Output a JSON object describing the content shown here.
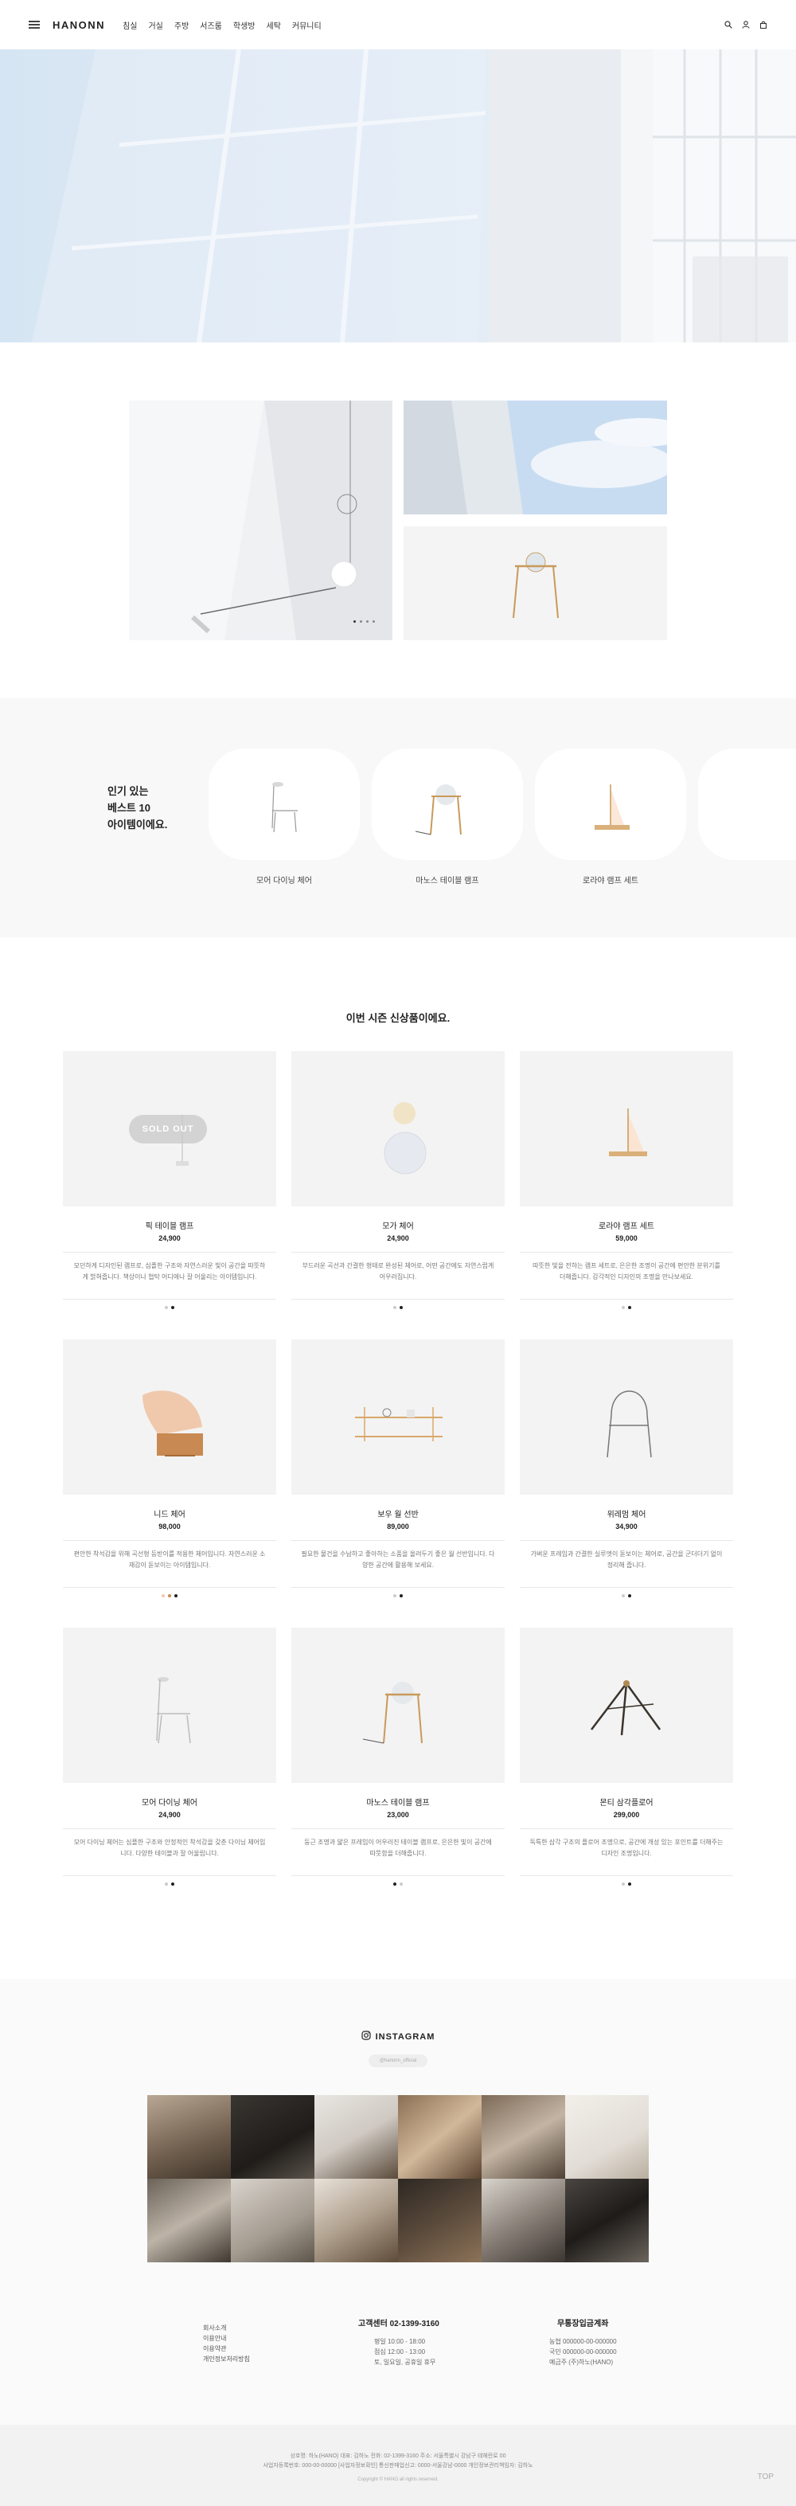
{
  "header": {
    "logo": "HANONN",
    "nav": [
      "침실",
      "거실",
      "주방",
      "서즈룸",
      "학생방",
      "세탁",
      "커뮤니티"
    ]
  },
  "best": {
    "title_lines": [
      "인기 있는",
      "베스트 10",
      "아이템이에요."
    ],
    "items": [
      "모어 다이닝 체어",
      "마노스 테이블 램프",
      "로라야 램프 세트"
    ]
  },
  "new_section": {
    "title": "이번 시즌 신상품이에요.",
    "sold_out": "SOLD OUT",
    "products": [
      {
        "name": "픽 테이블 램프",
        "price": "24,900",
        "desc": "모던하게 디자인된 램프로, 심플한 구조와 자연스러운 빛이 공간을 따뜻하게 밝혀줍니다. 책상이나 협탁 어디에나 잘 어울리는 아이템입니다."
      },
      {
        "name": "모가 체어",
        "price": "24,900",
        "desc": "부드러운 곡선과 간결한 형태로 완성된 체어로, 어떤 공간에도 자연스럽게 어우러집니다."
      },
      {
        "name": "로라야 램프 세트",
        "price": "59,000",
        "desc": "따뜻한 빛을 전하는 램프 세트로, 은은한 조명이 공간에 편안한 분위기를 더해줍니다. 감각적인 디자인의 조명을 만나보세요."
      },
      {
        "name": "니드 체어",
        "price": "98,000",
        "desc": "편안한 착석감을 위해 곡선형 등받이를 적용한 체어입니다. 자연스러운 소재감이 돋보이는 아이템입니다."
      },
      {
        "name": "보우 월 선반",
        "price": "89,000",
        "desc": "필요한 물건을 수납하고 좋아하는 소품을 올려두기 좋은 월 선반입니다. 다양한 공간에 활용해 보세요."
      },
      {
        "name": "위레멈 체어",
        "price": "34,900",
        "desc": "가벼운 프레임과 간결한 실루엣이 돋보이는 체어로, 공간을 군더더기 없이 정리해 줍니다."
      },
      {
        "name": "모어 다이닝 체어",
        "price": "24,900",
        "desc": "모어 다이닝 체어는 심플한 구조와 안정적인 착석감을 갖춘 다이닝 체어입니다. 다양한 테이블과 잘 어울립니다."
      },
      {
        "name": "마노스 테이블 램프",
        "price": "23,000",
        "desc": "둥근 조명과 얇은 프레임이 어우러진 테이블 램프로, 은은한 빛이 공간에 따뜻함을 더해줍니다."
      },
      {
        "name": "몬티 삼각플로어",
        "price": "299,000",
        "desc": "독특한 삼각 구조의 플로어 조명으로, 공간에 개성 있는 포인트를 더해주는 디자인 조명입니다."
      }
    ]
  },
  "instagram": {
    "title": "INSTAGRAM",
    "handle": "@hanonn_official"
  },
  "footer_links": [
    "회사소개",
    "이용안내",
    "이용약관",
    "개인정보처리방침"
  ],
  "customer_center": {
    "title": "고객센터  02-1399-3160",
    "lines": [
      "평일 10:00 - 18:00",
      "점심 12:00 - 13:00",
      "토, 일요일, 공휴일 휴무"
    ]
  },
  "bank": {
    "title": "무통장입금계좌",
    "lines": [
      "농협 000000-00-000000",
      "국민 000000-00-000000",
      "예금주 (주)하노(HANO)"
    ]
  },
  "footer": {
    "line1": "상호명: 하노(HANO)   대표: 김하노   전화: 02-1399-3160   주소: 서울특별시 강남구 테헤란로 00",
    "line2": "사업자등록번호: 000-00-00000 [사업자정보확인]   통신판매업신고: 0000-서울강남-0000   개인정보관리책임자: 김하노",
    "copyright": "Copyright © HANO all rights reserved.",
    "top": "TOP"
  }
}
